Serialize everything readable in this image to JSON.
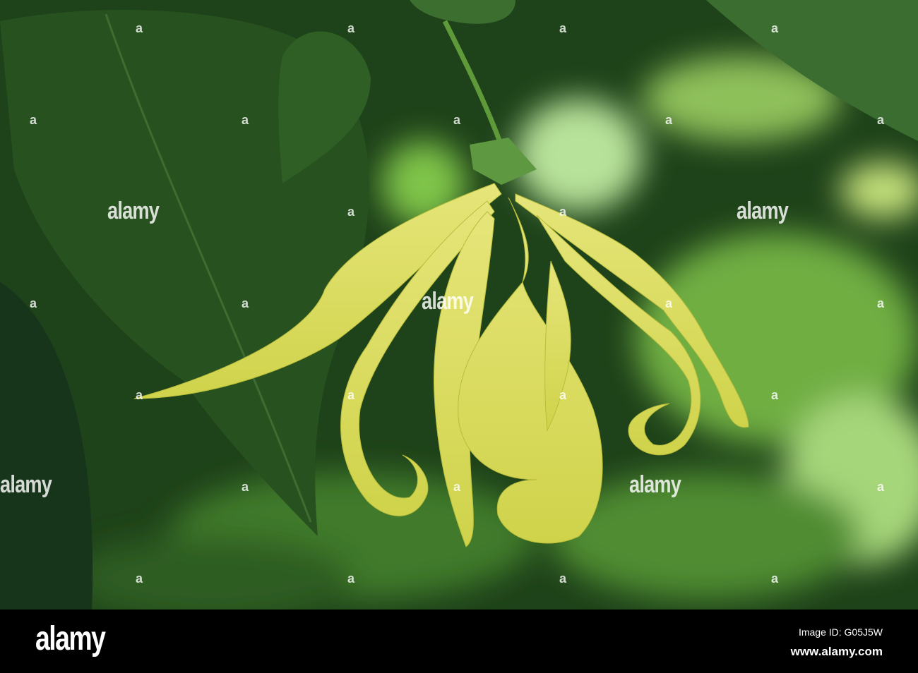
{
  "watermark": {
    "text": "alamy",
    "small": "a"
  },
  "footer": {
    "logo": "alamy",
    "image_id": "Image ID: G05J5W",
    "url": "www.alamy.com"
  },
  "colors": {
    "leaf_dark": "#1f4a1c",
    "petal": "#d9dc5a",
    "bokeh": "#8cc85a"
  }
}
